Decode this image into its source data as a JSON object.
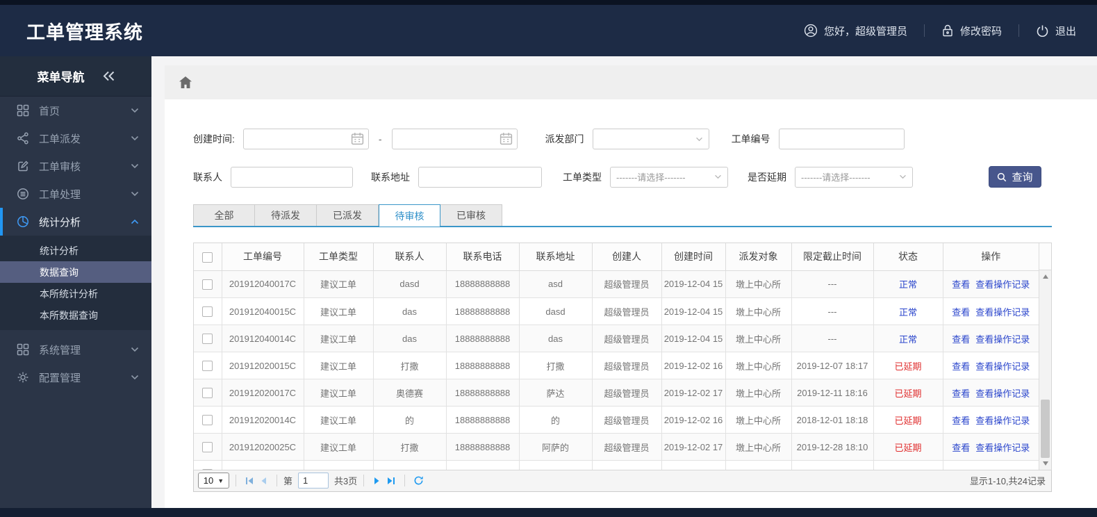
{
  "header": {
    "title": "工单管理系统",
    "greeting": "您好，超级管理员",
    "change_password": "修改密码",
    "logout": "退出"
  },
  "sidebar": {
    "nav_title": "菜单导航",
    "items": [
      {
        "label": "首页",
        "icon": "grid-icon"
      },
      {
        "label": "工单派发",
        "icon": "share-icon"
      },
      {
        "label": "工单审核",
        "icon": "edit-icon"
      },
      {
        "label": "工单处理",
        "icon": "process-icon"
      },
      {
        "label": "统计分析",
        "icon": "pie-icon",
        "expanded": true
      },
      {
        "label": "系统管理",
        "icon": "grid-icon"
      },
      {
        "label": "配置管理",
        "icon": "gear-icon"
      }
    ],
    "submenu": [
      {
        "label": "统计分析"
      },
      {
        "label": "数据查询",
        "selected": true
      },
      {
        "label": "本所统计分析"
      },
      {
        "label": "本所数据查询"
      }
    ]
  },
  "filters": {
    "created_time_label": "创建时间:",
    "range_dash": "-",
    "dept_label": "派发部门",
    "dept_value": "",
    "order_no_label": "工单编号",
    "contact_label": "联系人",
    "address_label": "联系地址",
    "type_label": "工单类型",
    "delay_label": "是否延期",
    "select_placeholder": "-------请选择-------",
    "query_button": "查询"
  },
  "tabs": [
    {
      "label": "全部"
    },
    {
      "label": "待派发"
    },
    {
      "label": "已派发"
    },
    {
      "label": "待审核",
      "active": true
    },
    {
      "label": "已审核"
    }
  ],
  "table": {
    "columns": [
      "工单编号",
      "工单类型",
      "联系人",
      "联系电话",
      "联系地址",
      "创建人",
      "创建时间",
      "派发对象",
      "限定截止时间",
      "状态",
      "操作"
    ],
    "rows": [
      {
        "id": "201912040017C",
        "type": "建议工单",
        "contact": "dasd",
        "phone": "18888888888",
        "address": "asd",
        "creator": "超级管理员",
        "created": "2019-12-04 15",
        "target": "墩上中心所",
        "deadline": "---",
        "status": "正常",
        "status_type": "normal",
        "view": "查看",
        "view_log": "查看操作记录"
      },
      {
        "id": "201912040015C",
        "type": "建议工单",
        "contact": "das",
        "phone": "18888888888",
        "address": "dasd",
        "creator": "超级管理员",
        "created": "2019-12-04 15",
        "target": "墩上中心所",
        "deadline": "---",
        "status": "正常",
        "status_type": "normal",
        "view": "查看",
        "view_log": "查看操作记录"
      },
      {
        "id": "201912040014C",
        "type": "建议工单",
        "contact": "das",
        "phone": "18888888888",
        "address": "das",
        "creator": "超级管理员",
        "created": "2019-12-04 15",
        "target": "墩上中心所",
        "deadline": "---",
        "status": "正常",
        "status_type": "normal",
        "view": "查看",
        "view_log": "查看操作记录"
      },
      {
        "id": "201912020015C",
        "type": "建议工单",
        "contact": "打撒",
        "phone": "18888888888",
        "address": "打撒",
        "creator": "超级管理员",
        "created": "2019-12-02 16",
        "target": "墩上中心所",
        "deadline": "2019-12-07 18:17",
        "status": "已延期",
        "status_type": "delayed",
        "view": "查看",
        "view_log": "查看操作记录"
      },
      {
        "id": "201912020017C",
        "type": "建议工单",
        "contact": "奥德赛",
        "phone": "18888888888",
        "address": "萨达",
        "creator": "超级管理员",
        "created": "2019-12-02 17",
        "target": "墩上中心所",
        "deadline": "2019-12-11 18:16",
        "status": "已延期",
        "status_type": "delayed",
        "view": "查看",
        "view_log": "查看操作记录"
      },
      {
        "id": "201912020014C",
        "type": "建议工单",
        "contact": "的",
        "phone": "18888888888",
        "address": "的",
        "creator": "超级管理员",
        "created": "2019-12-02 16",
        "target": "墩上中心所",
        "deadline": "2018-12-01 18:18",
        "status": "已延期",
        "status_type": "delayed",
        "view": "查看",
        "view_log": "查看操作记录"
      },
      {
        "id": "201912020025C",
        "type": "建议工单",
        "contact": "打撒",
        "phone": "18888888888",
        "address": "阿萨的",
        "creator": "超级管理员",
        "created": "2019-12-02 17",
        "target": "墩上中心所",
        "deadline": "2019-12-28 18:10",
        "status": "已延期",
        "status_type": "delayed",
        "view": "查看",
        "view_log": "查看操作记录"
      },
      {
        "id": "",
        "type": "",
        "contact": "",
        "phone": "",
        "address": "",
        "creator": "",
        "created": "",
        "target": "",
        "deadline": "",
        "status": "",
        "status_type": "none",
        "view": "",
        "view_log": ""
      }
    ]
  },
  "pagination": {
    "page_size": "10",
    "page_prefix": "第",
    "current_page": "1",
    "total_pages": "共3页",
    "summary": "显示1-10,共24记录"
  },
  "icons": {
    "collapse": "double-chevron-left",
    "user": "person-circle",
    "lock": "padlock",
    "power": "power-symbol",
    "home": "house",
    "calendar": "calendar-grid",
    "search": "magnifier",
    "refresh": "circular-arrow"
  },
  "colors": {
    "header_bg": "#1d2b45",
    "sidebar_bg": "#2b3547",
    "accent_blue": "#2196f3",
    "tab_blue": "#3a96c8",
    "link_blue": "#2b46cc",
    "delayed_red": "#e02e2e",
    "button_indigo": "#47568c"
  }
}
